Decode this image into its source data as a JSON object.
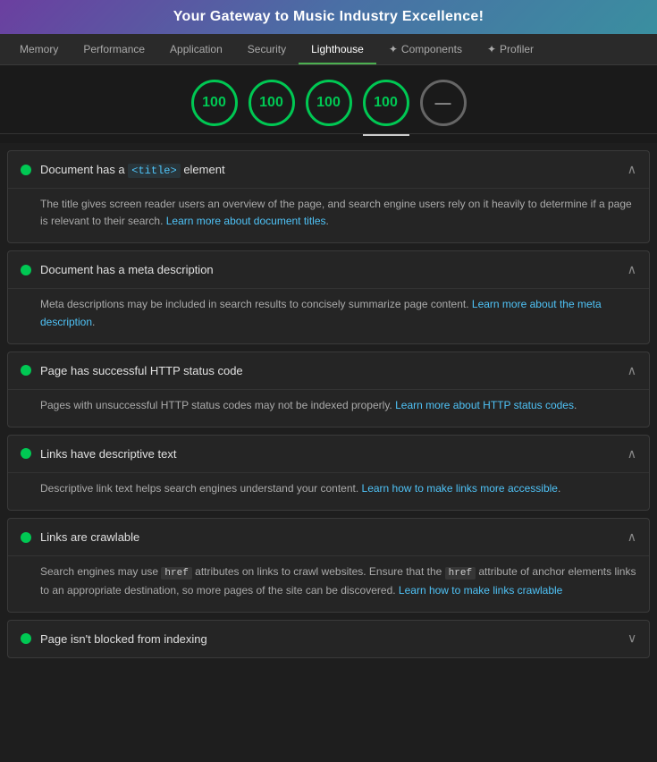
{
  "header": {
    "title": "Your Gateway to Music Industry Excellence!"
  },
  "nav": {
    "tabs": [
      {
        "id": "memory",
        "label": "Memory",
        "active": false,
        "icon": null
      },
      {
        "id": "performance",
        "label": "Performance",
        "active": false,
        "icon": null
      },
      {
        "id": "application",
        "label": "Application",
        "active": false,
        "icon": null
      },
      {
        "id": "security",
        "label": "Security",
        "active": false,
        "icon": null
      },
      {
        "id": "lighthouse",
        "label": "Lighthouse",
        "active": true,
        "icon": null
      },
      {
        "id": "components",
        "label": "Components",
        "active": false,
        "icon": "✦"
      },
      {
        "id": "profiler",
        "label": "Profiler",
        "active": false,
        "icon": "✦"
      }
    ]
  },
  "scores": {
    "items": [
      {
        "value": "100",
        "color": "green",
        "active": false
      },
      {
        "value": "100",
        "color": "green",
        "active": false
      },
      {
        "value": "100",
        "color": "green",
        "active": false
      },
      {
        "value": "100",
        "color": "green",
        "active": true
      },
      {
        "value": "—",
        "color": "gray",
        "active": false
      }
    ]
  },
  "audits": [
    {
      "id": "title-element",
      "status_dot_color": "#00c853",
      "title_prefix": "Document has a ",
      "title_code": "<title>",
      "title_suffix": " element",
      "expanded": true,
      "body": "The title gives screen reader users an overview of the page, and search engine users rely on it heavily to determine if a page is relevant to their search.",
      "link_text": "Learn more about document titles",
      "link_href": "#"
    },
    {
      "id": "meta-description",
      "status_dot_color": "#00c853",
      "title_prefix": "Document has a meta description",
      "title_code": null,
      "title_suffix": "",
      "expanded": true,
      "body": "Meta descriptions may be included in search results to concisely summarize page content.",
      "link_text": "Learn more about the meta description",
      "link_href": "#"
    },
    {
      "id": "http-status-code",
      "status_dot_color": "#00c853",
      "title_prefix": "Page has successful HTTP status code",
      "title_code": null,
      "title_suffix": "",
      "expanded": true,
      "body": "Pages with unsuccessful HTTP status codes may not be indexed properly.",
      "link_text": "Learn more about HTTP status codes",
      "link_href": "#"
    },
    {
      "id": "link-text",
      "status_dot_color": "#00c853",
      "title_prefix": "Links have descriptive text",
      "title_code": null,
      "title_suffix": "",
      "expanded": true,
      "body": "Descriptive link text helps search engines understand your content.",
      "link_text": "Learn how to make links more accessible",
      "link_href": "#"
    },
    {
      "id": "crawlable-anchors",
      "status_dot_color": "#00c853",
      "title_prefix": "Links are crawlable",
      "title_code": null,
      "title_suffix": "",
      "expanded": true,
      "body_prefix": "Search engines may use ",
      "body_code1": "href",
      "body_mid": " attributes on links to crawl websites. Ensure that the ",
      "body_code2": "href",
      "body_suffix": " attribute of anchor elements links to an appropriate destination, so more pages of the site can be discovered.",
      "link_text": "Learn how to make links crawlable",
      "link_href": "#",
      "has_code": true
    },
    {
      "id": "is-crawlable",
      "status_dot_color": "#00c853",
      "title_prefix": "Page isn't blocked from indexing",
      "title_code": null,
      "title_suffix": "",
      "expanded": false,
      "body": null,
      "link_text": null,
      "link_href": null
    }
  ]
}
